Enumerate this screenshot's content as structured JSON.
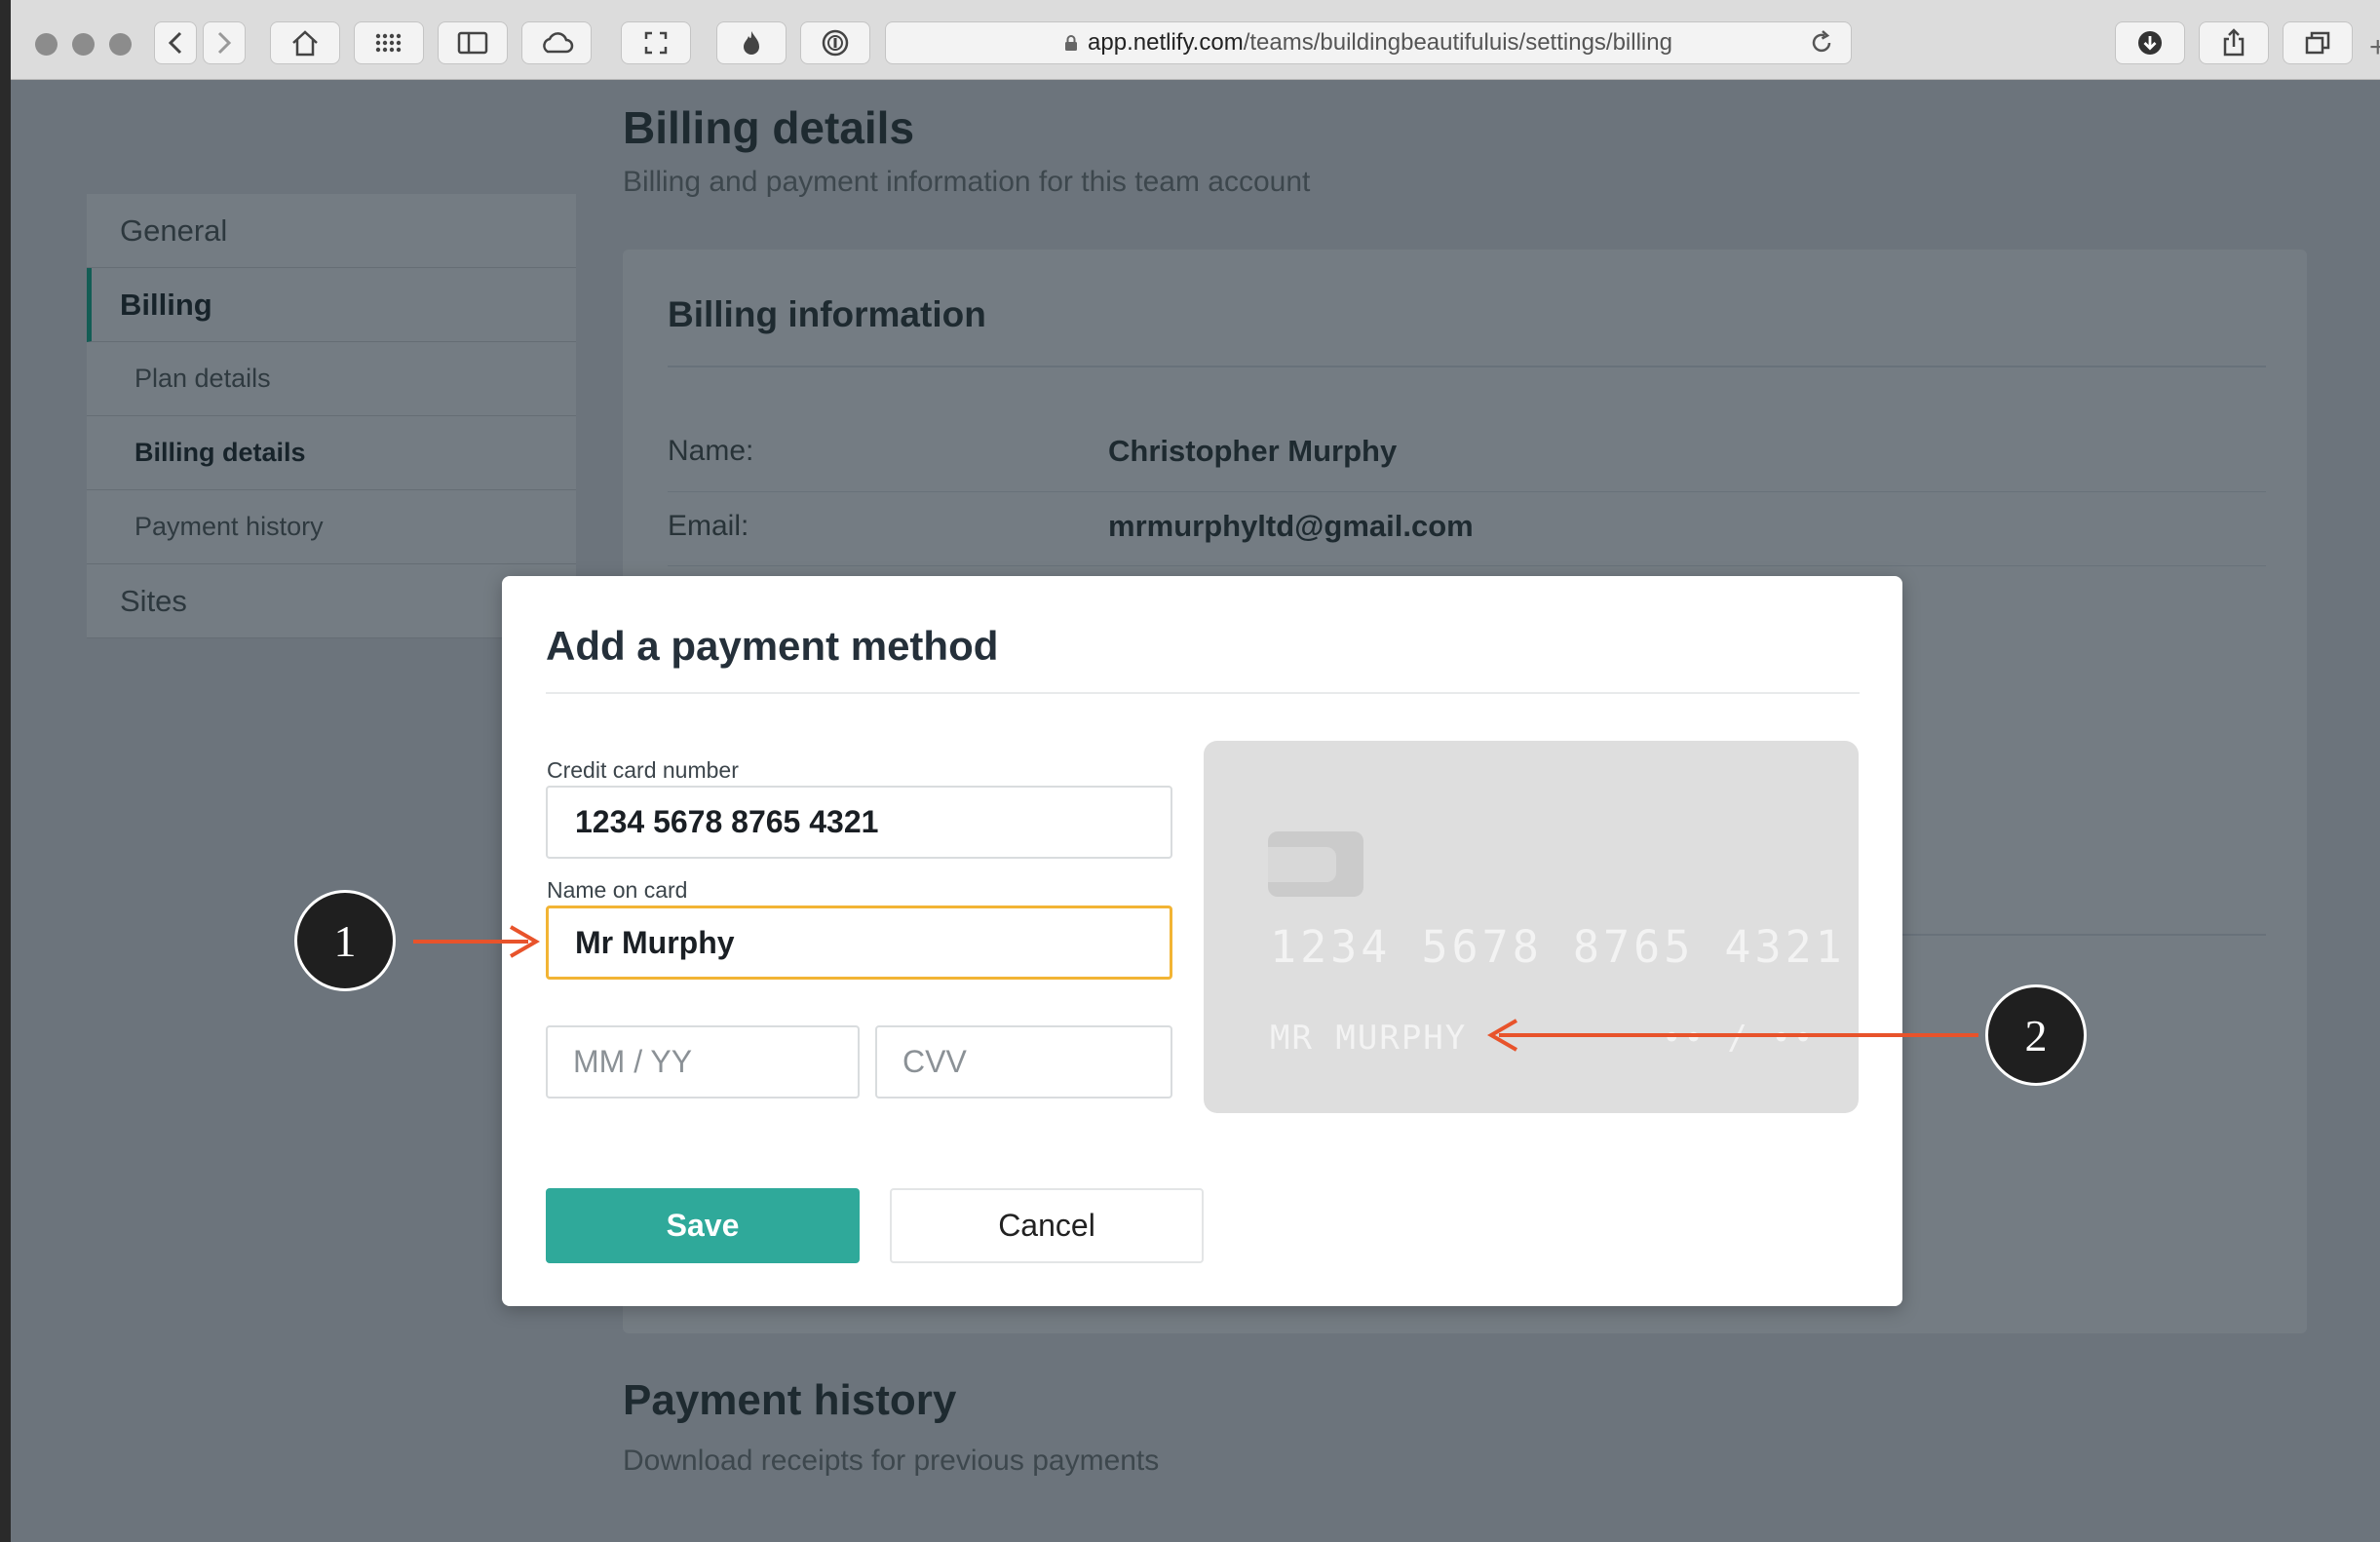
{
  "browser": {
    "url_host": "app.netlify.com",
    "url_path": "/teams/buildingbeautifuluis/settings/billing"
  },
  "page": {
    "title": "Billing details",
    "subtitle": "Billing and payment information for this team account"
  },
  "sidebar": {
    "items": [
      {
        "label": "General",
        "level": 0,
        "active": false
      },
      {
        "label": "Billing",
        "level": 0,
        "active": true
      },
      {
        "label": "Plan details",
        "level": 1,
        "active": false
      },
      {
        "label": "Billing details",
        "level": 1,
        "active": true
      },
      {
        "label": "Payment history",
        "level": 1,
        "active": false
      },
      {
        "label": "Sites",
        "level": 0,
        "active": false
      }
    ]
  },
  "billing_info": {
    "title": "Billing information",
    "name_label": "Name:",
    "name_value": "Christopher Murphy",
    "email_label": "Email:",
    "email_value": "mrmurphyltd@gmail.com"
  },
  "payment_history": {
    "title": "Payment history",
    "subtitle": "Download receipts for previous payments"
  },
  "modal": {
    "title": "Add a payment method",
    "card_number_label": "Credit card number",
    "card_number_value": "1234 5678 8765 4321",
    "name_label": "Name on card",
    "name_value": "Mr Murphy",
    "expiry_placeholder": "MM / YY",
    "cvv_placeholder": "CVV",
    "save_label": "Save",
    "cancel_label": "Cancel",
    "preview": {
      "number": "1234 5678 8765 4321",
      "name": "MR MURPHY",
      "expiry": "•• / ••"
    }
  },
  "annotations": {
    "callout_1": "1",
    "callout_2": "2",
    "arrow_color": "#e8532b"
  },
  "colors": {
    "accent": "#2fa99a",
    "focus_border": "#f2b434",
    "sidebar_active": "#135d55"
  }
}
